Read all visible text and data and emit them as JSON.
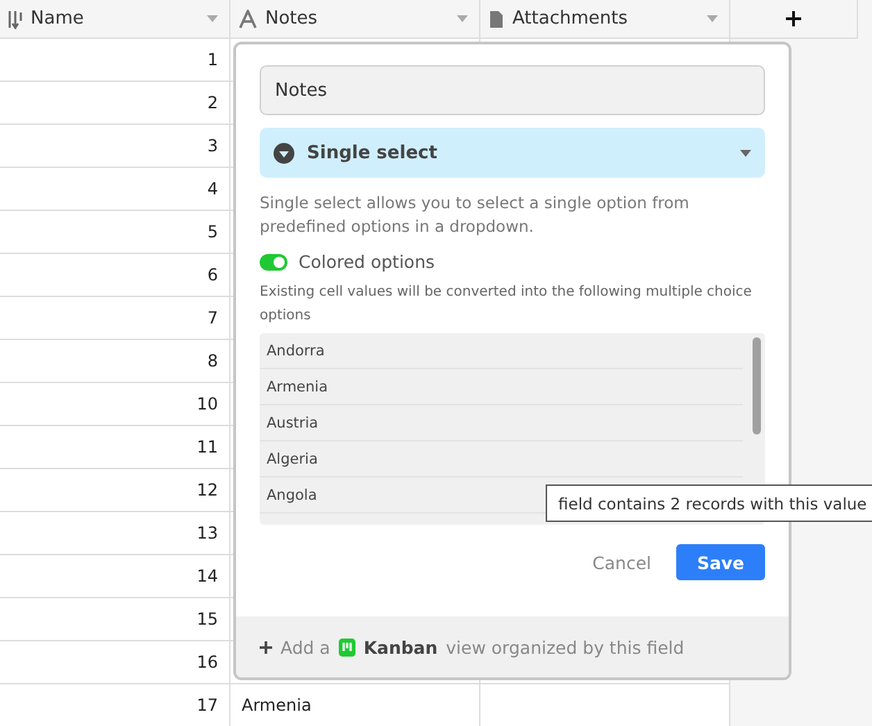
{
  "table": {
    "columns": [
      {
        "label": "Name",
        "kind": "number"
      },
      {
        "label": "Notes",
        "kind": "text"
      },
      {
        "label": "Attachments",
        "kind": "attachment"
      }
    ],
    "rows": [
      {
        "name": "1"
      },
      {
        "name": "2"
      },
      {
        "name": "3"
      },
      {
        "name": "4"
      },
      {
        "name": "5"
      },
      {
        "name": "6"
      },
      {
        "name": "7"
      },
      {
        "name": "8"
      },
      {
        "name": "10"
      },
      {
        "name": "11"
      },
      {
        "name": "12"
      },
      {
        "name": "13"
      },
      {
        "name": "14"
      },
      {
        "name": "15"
      },
      {
        "name": "16"
      },
      {
        "name": "17",
        "notes": "Armenia"
      }
    ]
  },
  "dialog": {
    "field_name": "Notes",
    "field_type": "Single select",
    "description": "Single select allows you to select a single option from predefined options in a dropdown.",
    "colored_options": {
      "label": "Colored options",
      "on": true
    },
    "conversion_note": "Existing cell values will be converted into the following multiple choice options",
    "options": [
      "Andorra",
      "Armenia",
      "Austria",
      "Algeria",
      "Angola"
    ],
    "cancel": "Cancel",
    "save": "Save",
    "footer": {
      "prefix": "Add a",
      "view": "Kanban",
      "suffix": "view organized by this field"
    }
  },
  "tooltip": "field contains 2 records with this value"
}
